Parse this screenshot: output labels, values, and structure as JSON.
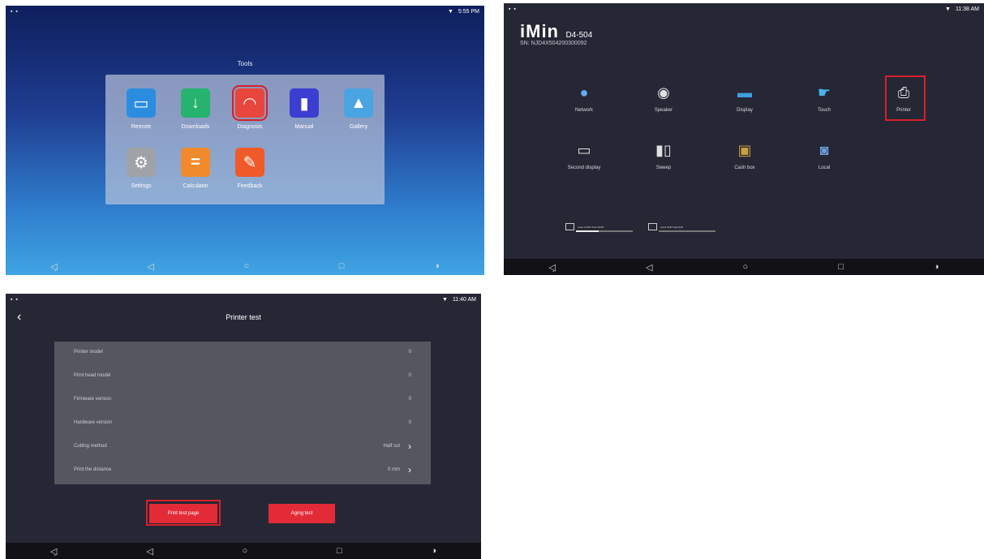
{
  "screen1": {
    "status": {
      "left": "▪ ▪",
      "time": "5:55 PM"
    },
    "title": "Tools",
    "apps": [
      {
        "label": "Remote",
        "icon": "monitor-icon",
        "color": "#2a8de0"
      },
      {
        "label": "Downloads",
        "icon": "download-icon",
        "color": "#25b36d"
      },
      {
        "label": "Diagnosis",
        "icon": "speedometer-icon",
        "color": "#e8453c"
      },
      {
        "label": "Manual",
        "icon": "book-icon",
        "color": "#3b3fd1"
      },
      {
        "label": "Gallery",
        "icon": "picture-icon",
        "color": "#4aa3e2"
      },
      {
        "label": "Settings",
        "icon": "gear-icon",
        "color": "#9fa3a8"
      },
      {
        "label": "Calculator",
        "icon": "calculator-icon",
        "color": "#f08a2c"
      },
      {
        "label": "Feedback",
        "icon": "pencil-icon",
        "color": "#f05a2a"
      }
    ]
  },
  "screen2": {
    "status": {
      "left": "▪ ▪",
      "time": "11:38 AM"
    },
    "brand": {
      "logo": "iMin",
      "model": "D4-504",
      "sn": "SN: NJD4X504200300092"
    },
    "devices": [
      {
        "label": "Network",
        "icon": "globe-icon"
      },
      {
        "label": "Speaker",
        "icon": "speaker-icon"
      },
      {
        "label": "Display",
        "icon": "display-icon"
      },
      {
        "label": "Touch",
        "icon": "touch-icon"
      },
      {
        "label": "Printer",
        "icon": "printer-icon"
      },
      {
        "label": "Second display",
        "icon": "second-display-icon"
      },
      {
        "label": "Sweep",
        "icon": "scanner-icon"
      },
      {
        "label": "Cash box",
        "icon": "cash-box-icon"
      },
      {
        "label": "Local",
        "icon": "local-icon"
      }
    ],
    "storage": [
      {
        "text": "Used 0.9GB Total 16GB",
        "fill": 0.4
      },
      {
        "text": "Used 0GB Total 0GB",
        "fill": 0.0
      }
    ]
  },
  "screen3": {
    "status": {
      "left": "▪ ▪",
      "time": "11:40 AM"
    },
    "title": "Printer test",
    "rows": [
      {
        "label": "Printer model",
        "value": "0"
      },
      {
        "label": "Print head model",
        "value": "0"
      },
      {
        "label": "Firmware version",
        "value": "0"
      },
      {
        "label": "Hardware version",
        "value": "0"
      },
      {
        "label": "Cutting method",
        "value": "Half cut"
      },
      {
        "label": "Print the distance",
        "value": "0 mm"
      }
    ],
    "buttons": {
      "print": "Print test page",
      "aging": "Aging test"
    }
  },
  "colors": {
    "highlight": "#d81f2a",
    "button": "#e32b38",
    "dark_bg": "#262734"
  }
}
